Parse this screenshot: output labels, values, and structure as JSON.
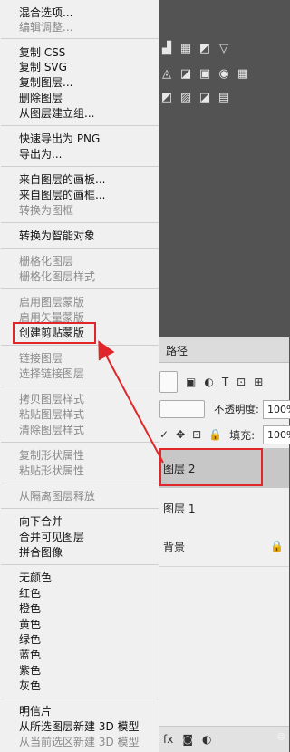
{
  "menu": {
    "items": [
      {
        "label": "混合选项...",
        "enabled": true
      },
      {
        "label": "编辑调整...",
        "enabled": false
      },
      {
        "label": "复制 CSS",
        "enabled": true
      },
      {
        "label": "复制 SVG",
        "enabled": true
      },
      {
        "label": "复制图层...",
        "enabled": true
      },
      {
        "label": "删除图层",
        "enabled": true
      },
      {
        "label": "从图层建立组...",
        "enabled": true
      },
      {
        "label": "快速导出为 PNG",
        "enabled": true
      },
      {
        "label": "导出为...",
        "enabled": true
      },
      {
        "label": "来自图层的画板...",
        "enabled": true
      },
      {
        "label": "来自图层的画框...",
        "enabled": true
      },
      {
        "label": "转换为图框",
        "enabled": false
      },
      {
        "label": "转换为智能对象",
        "enabled": true
      },
      {
        "label": "栅格化图层",
        "enabled": false
      },
      {
        "label": "栅格化图层样式",
        "enabled": false
      },
      {
        "label": "启用图层蒙版",
        "enabled": false
      },
      {
        "label": "启用矢量蒙版",
        "enabled": false
      },
      {
        "label": "创建剪贴蒙版",
        "enabled": true
      },
      {
        "label": "链接图层",
        "enabled": false
      },
      {
        "label": "选择链接图层",
        "enabled": false
      },
      {
        "label": "拷贝图层样式",
        "enabled": false
      },
      {
        "label": "粘贴图层样式",
        "enabled": false
      },
      {
        "label": "清除图层样式",
        "enabled": false
      },
      {
        "label": "复制形状属性",
        "enabled": false
      },
      {
        "label": "粘贴形状属性",
        "enabled": false
      },
      {
        "label": "从隔离图层释放",
        "enabled": false
      },
      {
        "label": "向下合并",
        "enabled": true
      },
      {
        "label": "合并可见图层",
        "enabled": true
      },
      {
        "label": "拼合图像",
        "enabled": true
      },
      {
        "label": "无颜色",
        "enabled": true
      },
      {
        "label": "红色",
        "enabled": true
      },
      {
        "label": "橙色",
        "enabled": true
      },
      {
        "label": "黄色",
        "enabled": true
      },
      {
        "label": "绿色",
        "enabled": true
      },
      {
        "label": "蓝色",
        "enabled": true
      },
      {
        "label": "紫色",
        "enabled": true
      },
      {
        "label": "灰色",
        "enabled": true
      },
      {
        "label": "明信片",
        "enabled": true
      },
      {
        "label": "从所选图层新建 3D 模型",
        "enabled": true
      },
      {
        "label": "从当前选区新建 3D 模型",
        "enabled": false
      }
    ]
  },
  "panel": {
    "tab_label": "路径",
    "opacity_label": "不透明度:",
    "opacity_value": "100%",
    "fill_label": "填充:",
    "fill_value": "100%",
    "layers": [
      "图层 2",
      "图层 1",
      "背景"
    ],
    "selected_layer": "图层 2"
  },
  "annotation": {
    "color": "#e0262a"
  }
}
